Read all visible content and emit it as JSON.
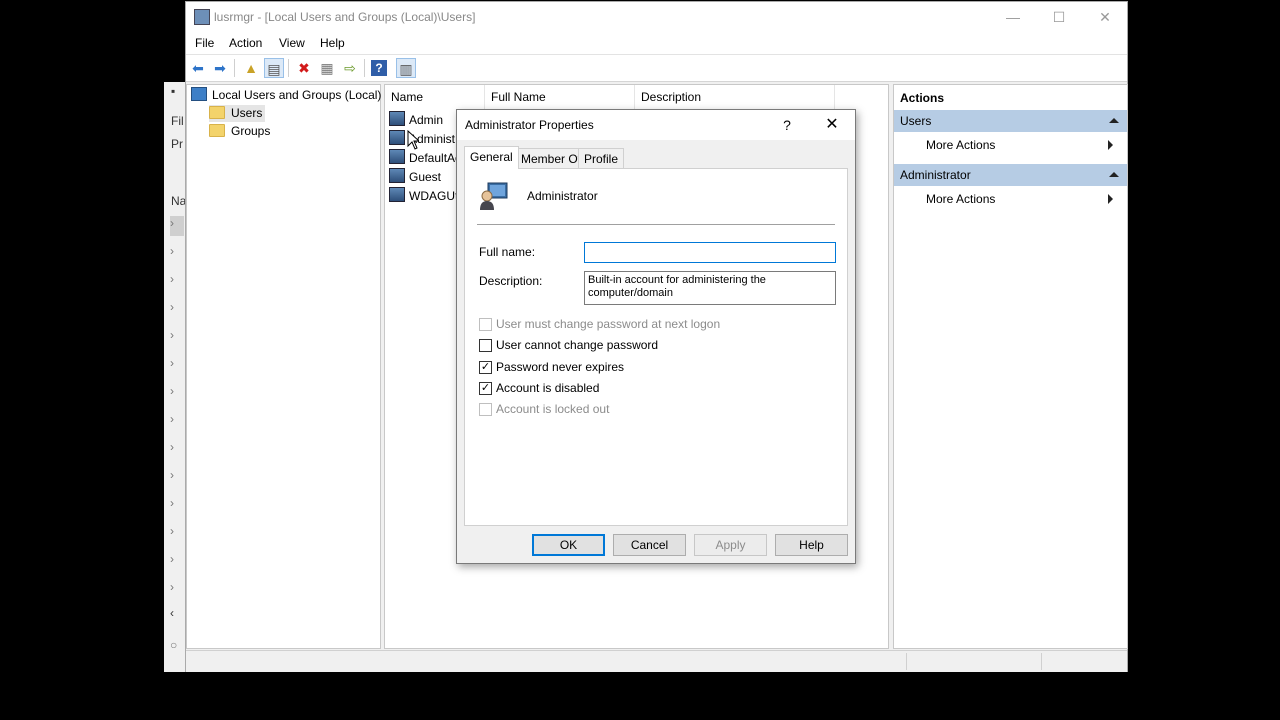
{
  "window": {
    "title": "lusrmgr - [Local Users and Groups (Local)\\Users]",
    "minimize_glyph": "—",
    "maximize_glyph": "☐",
    "close_glyph": "✕"
  },
  "menu": [
    "File",
    "Action",
    "View",
    "Help"
  ],
  "toolbar": {
    "icons": [
      "back-icon",
      "forward-icon",
      "up-folder-icon",
      "show-hide-tree-icon",
      "delete-icon",
      "properties-icon",
      "export-icon",
      "help-icon",
      "action-pane-icon"
    ]
  },
  "background_window": {
    "fragments": [
      "Fil",
      "Pr",
      "Na"
    ]
  },
  "tree": {
    "root": "Local Users and Groups (Local)",
    "items": [
      "Users",
      "Groups"
    ]
  },
  "list": {
    "columns": [
      "Name",
      "Full Name",
      "Description"
    ],
    "rows": [
      "Admin",
      "Administ",
      "DefaultAc",
      "Guest",
      "WDAGUti"
    ]
  },
  "actions": {
    "header": "Actions",
    "sections": [
      {
        "title": "Users",
        "item": "More Actions"
      },
      {
        "title": "Administrator",
        "item": "More Actions"
      }
    ]
  },
  "dialog": {
    "title": "Administrator Properties",
    "help_glyph": "?",
    "close_glyph": "✕",
    "tabs": [
      "General",
      "Member Of",
      "Profile"
    ],
    "active_tab": "General",
    "username": "Administrator",
    "full_name_label": "Full name:",
    "full_name_value": "",
    "description_label": "Description:",
    "description_value": "Built-in account for administering the computer/domain",
    "checkboxes": [
      {
        "label": "User must change password at next logon",
        "checked": false,
        "enabled": false
      },
      {
        "label": "User cannot change password",
        "checked": false,
        "enabled": true
      },
      {
        "label": "Password never expires",
        "checked": true,
        "enabled": true
      },
      {
        "label": "Account is disabled",
        "checked": true,
        "enabled": true
      },
      {
        "label": "Account is locked out",
        "checked": false,
        "enabled": false
      }
    ],
    "buttons": {
      "ok": "OK",
      "cancel": "Cancel",
      "apply": "Apply",
      "help": "Help"
    }
  }
}
